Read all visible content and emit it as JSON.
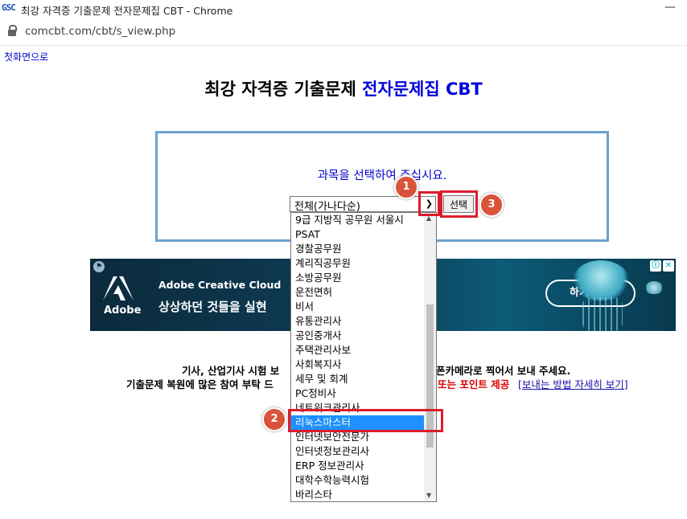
{
  "window": {
    "app_icon": "GSC",
    "title": "최강 자격증 기출문제 전자문제집 CBT - Chrome",
    "minimize": "—"
  },
  "address_bar": {
    "url": "comcbt.com/cbt/s_view.php"
  },
  "page": {
    "home_link": "첫화면으로",
    "title_plain": "최강 자격증 기출문제 ",
    "title_highlight": "전자문제집 CBT",
    "prompt": "과목을 선택하여 주십시요."
  },
  "subject_select": {
    "selected_value": "전체(가나다순)",
    "button_label": "선택",
    "options": [
      "9급 지방직 공무원 서울시",
      "PSAT",
      "경찰공무원",
      "계리직공무원",
      "소방공무원",
      "운전면허",
      "비서",
      "유통관리사",
      "공인중개사",
      "주택관리사보",
      "사회복지사",
      "세무 및 회계",
      "PC정비사",
      "네트워크관리사",
      "리눅스마스터",
      "인터넷보안전문가",
      "인터넷정보관리사",
      "ERP 정보관리사",
      "대학수학능력시험",
      "바리스타"
    ],
    "highlighted_option": "리눅스마스터"
  },
  "ad": {
    "brand": "Adobe",
    "headline": "Adobe Creative Cloud",
    "tagline": "상상하던 것들을 실현",
    "cta": "하기",
    "info_icon": "ⓘ",
    "close_icon": "✕"
  },
  "info": {
    "line1_left": "기사, 산업기사 시험 보",
    "line1_right": "폰카메라로 찍어서 보내 주세요.",
    "line2_left": "기출문제 복원에 많은 참여 부탁 드",
    "line2_red": "또는 포인트 제공",
    "line2_link": "[보내는 방법 자세히 보기]"
  },
  "annotations": {
    "callout_1": "1",
    "callout_2": "2",
    "callout_3": "3"
  },
  "colors": {
    "callout": "#d9523a",
    "highlight": "#dd1c2a",
    "title_blue": "#0000dd",
    "select_box_border": "#6e9fcf"
  }
}
